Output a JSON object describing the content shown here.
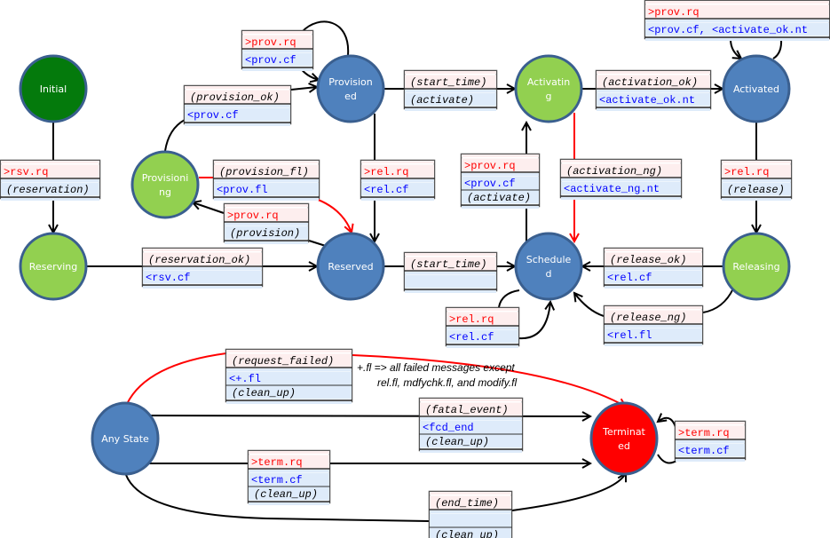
{
  "colors": {
    "initial": "#047a0c",
    "transient": "#92d050",
    "stable": "#4f81bd",
    "terminated": "#ff0000",
    "node_border": "#3a5f8f",
    "event_bg": "#fdeeee",
    "action_bg": "#deebfa",
    "send_text": "#ff0000",
    "recv_text": "#0000ff",
    "failure_edge": "#ff0000"
  },
  "nodes": {
    "initial": {
      "lines": [
        "Initial"
      ],
      "type": "initial"
    },
    "reserving": {
      "lines": [
        "Reserving"
      ],
      "type": "transient"
    },
    "provisioning": {
      "lines": [
        "Provisioni",
        "ng"
      ],
      "type": "transient"
    },
    "provisioned": {
      "lines": [
        "Provision",
        "ed"
      ],
      "type": "stable"
    },
    "reserved": {
      "lines": [
        "Reserved"
      ],
      "type": "stable"
    },
    "activating": {
      "lines": [
        "Activatin",
        "g"
      ],
      "type": "transient"
    },
    "scheduled": {
      "lines": [
        "Schedule",
        "d"
      ],
      "type": "stable"
    },
    "activated": {
      "lines": [
        "Activated"
      ],
      "type": "stable"
    },
    "releasing": {
      "lines": [
        "Releasing"
      ],
      "type": "transient"
    },
    "any_state": {
      "lines": [
        "Any State"
      ],
      "type": "stable"
    },
    "terminated": {
      "lines": [
        "Terminat",
        "ed"
      ],
      "type": "terminated"
    }
  },
  "transitions": {
    "rsv": {
      "rows": [
        {
          "t": ">rsv.rq",
          "s": "p"
        },
        {
          "t": "(reservation)",
          "s": "b"
        }
      ]
    },
    "prov_self": {
      "rows": [
        {
          "t": ">prov.rq",
          "s": "p"
        },
        {
          "t": "<prov.cf",
          "s": "b"
        }
      ]
    },
    "provision_ok": {
      "rows": [
        {
          "t": "(provision_ok)",
          "s": "p"
        },
        {
          "t": "<prov.cf",
          "s": "b"
        }
      ]
    },
    "provision_fl": {
      "rows": [
        {
          "t": "(provision_fl)",
          "s": "p"
        },
        {
          "t": "<prov.fl",
          "s": "b"
        }
      ]
    },
    "provision": {
      "rows": [
        {
          "t": ">prov.rq",
          "s": "p"
        },
        {
          "t": "(provision)",
          "s": "b"
        }
      ]
    },
    "reservation_ok": {
      "rows": [
        {
          "t": "(reservation_ok)",
          "s": "p"
        },
        {
          "t": "<rsv.cf",
          "s": "b"
        }
      ]
    },
    "rel_prov": {
      "rows": [
        {
          "t": ">rel.rq",
          "s": "p"
        },
        {
          "t": "<rel.cf",
          "s": "b"
        }
      ]
    },
    "start_time_act": {
      "rows": [
        {
          "t": "(start_time)",
          "s": "p"
        },
        {
          "t": "(activate)",
          "s": "b"
        }
      ]
    },
    "start_time_sched": {
      "rows": [
        {
          "t": "(start_time)",
          "s": "p"
        },
        {
          "t": "",
          "s": "b"
        }
      ]
    },
    "activate_sched": {
      "rows": [
        {
          "t": ">prov.rq",
          "s": "p"
        },
        {
          "t": "<prov.cf",
          "s": "b"
        },
        {
          "t": "(activate)",
          "s": "b"
        }
      ]
    },
    "activation_ng": {
      "rows": [
        {
          "t": "(activation_ng)",
          "s": "p"
        },
        {
          "t": "<activate_ng.nt",
          "s": "b"
        }
      ]
    },
    "activation_ok": {
      "rows": [
        {
          "t": "(activation_ok)",
          "s": "p"
        },
        {
          "t": "<activate_ok.nt",
          "s": "b"
        }
      ]
    },
    "activated_self": {
      "rows": [
        {
          "t": ">prov.rq",
          "s": "p"
        },
        {
          "t": "<prov.cf, <activate_ok.nt",
          "s": "b"
        }
      ]
    },
    "release": {
      "rows": [
        {
          "t": ">rel.rq",
          "s": "p"
        },
        {
          "t": "(release)",
          "s": "b"
        }
      ]
    },
    "release_ok": {
      "rows": [
        {
          "t": "(release_ok)",
          "s": "p"
        },
        {
          "t": "<rel.cf",
          "s": "b"
        }
      ]
    },
    "release_ng": {
      "rows": [
        {
          "t": "(release_ng)",
          "s": "p"
        },
        {
          "t": "<rel.fl",
          "s": "b"
        }
      ]
    },
    "sched_self": {
      "rows": [
        {
          "t": ">rel.rq",
          "s": "p"
        },
        {
          "t": "<rel.cf",
          "s": "b"
        }
      ]
    },
    "request_failed": {
      "rows": [
        {
          "t": "(request_failed)",
          "s": "p"
        },
        {
          "t": "<+.fl",
          "s": "b"
        },
        {
          "t": "(clean_up)",
          "s": "b"
        }
      ]
    },
    "fatal_event": {
      "rows": [
        {
          "t": "(fatal_event)",
          "s": "p"
        },
        {
          "t": "<fcd_end",
          "s": "b"
        },
        {
          "t": "(clean_up)",
          "s": "b"
        }
      ]
    },
    "term": {
      "rows": [
        {
          "t": ">term.rq",
          "s": "p"
        },
        {
          "t": "<term.cf",
          "s": "b"
        },
        {
          "t": "(clean_up)",
          "s": "b"
        }
      ]
    },
    "end_time": {
      "rows": [
        {
          "t": "(end_time)",
          "s": "p"
        },
        {
          "t": "",
          "s": "b"
        },
        {
          "t": "(clean_up)",
          "s": "b"
        }
      ]
    },
    "term_self": {
      "rows": [
        {
          "t": ">term.rq",
          "s": "p"
        },
        {
          "t": "<term.cf",
          "s": "b"
        }
      ]
    }
  },
  "note": {
    "line1": "+.fl => all failed messages except",
    "line2": "rel.fl, mdfychk.fl, and modify.fl"
  }
}
